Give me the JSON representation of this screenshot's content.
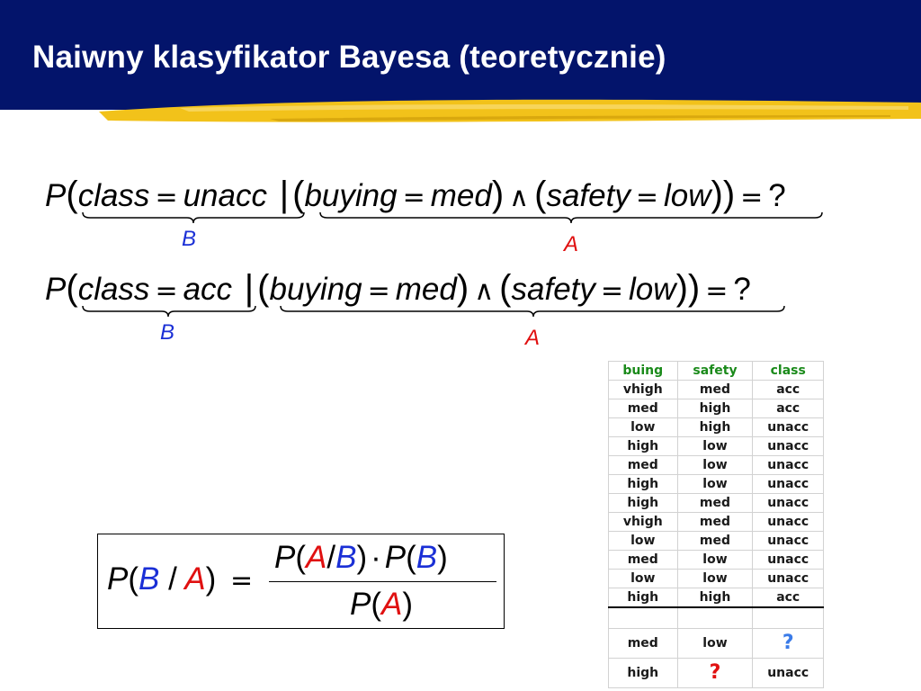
{
  "slide": {
    "title": "Naiwny klasyfikator Bayesa (teoretycznie)"
  },
  "equations": [
    {
      "P": "P",
      "open": "(",
      "class_var": "class",
      "eq1": "=",
      "class_val": "unacc",
      "bar": "|",
      "paren_open": "(",
      "buy_var": "buying",
      "eq2": "=",
      "buy_val": "med",
      "paren_close": ")",
      "and": "∧",
      "paren_open2": "(",
      "safety_var": "safety",
      "eq3": "=",
      "safety_val": "low",
      "paren_close2": "))",
      "eq4": "=",
      "result": "?",
      "label_B": "B",
      "label_A": "A"
    },
    {
      "P": "P",
      "open": "(",
      "class_var": "class",
      "eq1": "=",
      "class_val": "acc",
      "bar": "|",
      "paren_open": "(",
      "buy_var": "buying",
      "eq2": "=",
      "buy_val": "med",
      "paren_close": ")",
      "and": "∧",
      "paren_open2": "(",
      "safety_var": "safety",
      "eq3": "=",
      "safety_val": "low",
      "paren_close2": "))",
      "eq4": "=",
      "result": "?",
      "label_B": "B",
      "label_A": "A"
    }
  ],
  "bayes": {
    "lhs_P": "P",
    "lhs_open": "(",
    "lhs_B": "B",
    "lhs_slash": "/",
    "lhs_A": "A",
    "lhs_close": ")",
    "equals": "=",
    "num_P1": "P",
    "num_open1": "(",
    "num_A": "A",
    "num_slash": "/",
    "num_B": "B",
    "num_close1": ")",
    "num_dot": "·",
    "num_P2": "P",
    "num_open2": "(",
    "num_B2": "B",
    "num_close2": ")",
    "den_P": "P",
    "den_open": "(",
    "den_A": "A",
    "den_close": ")"
  },
  "table": {
    "headers": [
      "buing",
      "safety",
      "class"
    ],
    "rows": [
      [
        "vhigh",
        "med",
        "acc"
      ],
      [
        "med",
        "high",
        "acc"
      ],
      [
        "low",
        "high",
        "unacc"
      ],
      [
        "high",
        "low",
        "unacc"
      ],
      [
        "med",
        "low",
        "unacc"
      ],
      [
        "high",
        "low",
        "unacc"
      ],
      [
        "high",
        "med",
        "unacc"
      ],
      [
        "vhigh",
        "med",
        "unacc"
      ],
      [
        "low",
        "med",
        "unacc"
      ],
      [
        "med",
        "low",
        "unacc"
      ],
      [
        "low",
        "low",
        "unacc"
      ],
      [
        "high",
        "high",
        "acc"
      ]
    ],
    "query_rows": [
      [
        "med",
        "low",
        "?"
      ],
      [
        "high",
        "?",
        "unacc"
      ]
    ]
  },
  "colors": {
    "title_bg": "#03146b",
    "brush": "#f2c21a",
    "label_B": "#1a2fd6",
    "label_A": "#e01010",
    "header_green": "#1a8a1a",
    "qmark_blue": "#3a7be8",
    "qmark_red": "#e01010"
  }
}
